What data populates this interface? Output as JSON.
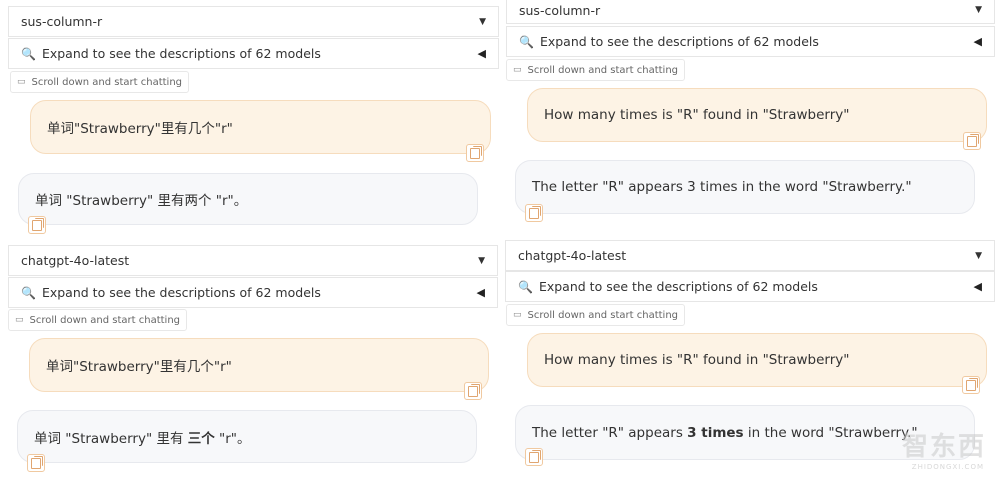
{
  "panels": [
    {
      "model": "sus-column-r",
      "expand_label": "Expand to see the descriptions of 62 models",
      "hint": "Scroll down and start chatting",
      "user_msg": "单词\"Strawberry\"里有几个\"r\"",
      "bot_msg_pre": "单词 \"Strawberry\" 里有两个 \"r\"。",
      "bot_msg_bold": "",
      "bot_msg_post": ""
    },
    {
      "model": "sus-column-r",
      "expand_label": "Expand to see the descriptions of 62 models",
      "hint": "Scroll down and start chatting",
      "user_msg": "How many times is \"R\" found in \"Strawberry\"",
      "bot_msg_pre": "The letter \"R\" appears 3 times in the word \"Strawberry.\"",
      "bot_msg_bold": "",
      "bot_msg_post": ""
    },
    {
      "model": "chatgpt-4o-latest",
      "expand_label": "Expand to see the descriptions of 62 models",
      "hint": "Scroll down and start chatting",
      "user_msg": "单词\"Strawberry\"里有几个\"r\"",
      "bot_msg_pre": "单词 \"Strawberry\" 里有 ",
      "bot_msg_bold": "三个",
      "bot_msg_post": " \"r\"。"
    },
    {
      "model": "chatgpt-4o-latest",
      "expand_label": "Expand to see the descriptions of 62 models",
      "hint": "Scroll down and start chatting",
      "user_msg": "How many times is \"R\" found in \"Strawberry\"",
      "bot_msg_pre": "The letter \"R\" appears ",
      "bot_msg_bold": "3 times",
      "bot_msg_post": " in the word \"Strawberry.\""
    }
  ],
  "icons": {
    "search": "magnifier-icon",
    "dropdown": "chevron-down-icon",
    "collapse": "triangle-left-icon",
    "hint": "chat-bubble-icon",
    "copy": "copy-icon"
  },
  "colors": {
    "user_bubble": "#fdf3e5",
    "bot_bubble": "#f7f8fa",
    "copy_accent": "#e0a570"
  },
  "watermark": {
    "main": "智东西",
    "sub": "ZHIDONGXI.COM"
  }
}
